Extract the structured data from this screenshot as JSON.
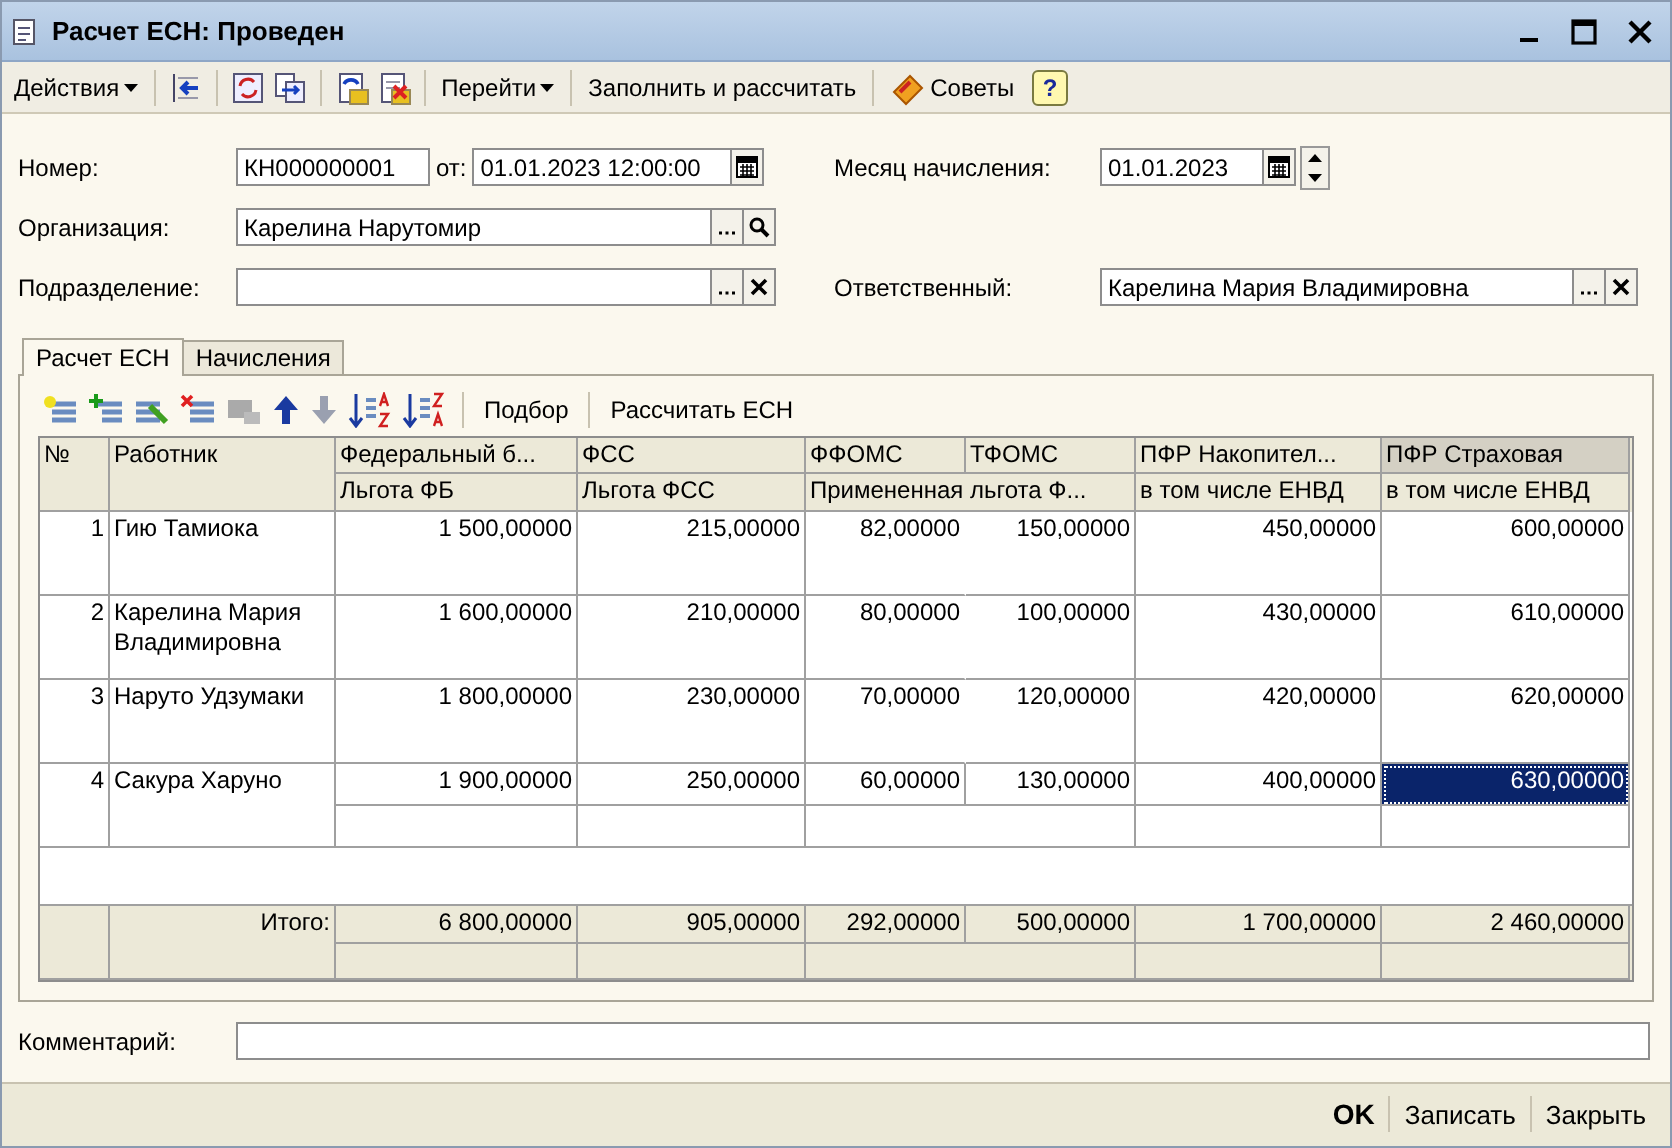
{
  "window": {
    "title": "Расчет ЕСН: Проведен"
  },
  "toolbar": {
    "actions_menu": "Действия",
    "goto_menu": "Перейти",
    "fill_button": "Заполнить и рассчитать",
    "tips_button": "Советы",
    "help_button": "?"
  },
  "form": {
    "number": {
      "label": "Номер:",
      "value": "КН000000001"
    },
    "date": {
      "label": "от:",
      "value": "01.01.2023 12:00:00"
    },
    "month": {
      "label": "Месяц начисления:",
      "value": "01.01.2023"
    },
    "organization": {
      "label": "Организация:",
      "value": "Карелина Нарутомир"
    },
    "subdivision": {
      "label": "Подразделение:"
    },
    "responsible": {
      "label": "Ответственный:",
      "value": "Карелина Мария Владимировна"
    }
  },
  "tabs": [
    {
      "label": "Расчет ЕСН",
      "selected": true
    },
    {
      "label": "Начисления",
      "selected": false
    }
  ],
  "table_toolbar": {
    "buttons": [
      "Подбор",
      "Рассчитать ЕСН"
    ]
  },
  "table": {
    "columns": [
      {
        "text": "№",
        "selected": false
      },
      {
        "text": "Работник",
        "selected": false
      },
      {
        "text": "Федеральный б...",
        "selected": false
      },
      {
        "text": "ФСС",
        "selected": false
      },
      {
        "text": "ФФОМС",
        "selected": false
      },
      {
        "text": "ТФОМС",
        "selected": false
      },
      {
        "text": "ПФР Накопител...",
        "selected": false
      },
      {
        "text": "ПФР Страховая",
        "selected": true
      }
    ],
    "subheaders": [
      "Льгота ФБ",
      "Льгота ФСС",
      "Примененная льгота Ф...",
      "в том числе ЕНВД",
      "в том числе ЕНВД"
    ],
    "rows": [
      {
        "num": "1",
        "name": "Гию Тамиока",
        "selected": false,
        "values": [
          {
            "text": "1 500,00000",
            "selected": false
          },
          {
            "text": "215,00000",
            "selected": false
          },
          {
            "text": "82,00000",
            "selected": false
          },
          {
            "text": "150,00000",
            "selected": false
          },
          {
            "text": "450,00000",
            "selected": false
          },
          {
            "text": "600,00000",
            "selected": false
          }
        ]
      },
      {
        "num": "2",
        "name": "Карелина Мария Владимировна",
        "selected": false,
        "values": [
          {
            "text": "1 600,00000",
            "selected": false
          },
          {
            "text": "210,00000",
            "selected": false
          },
          {
            "text": "80,00000",
            "selected": false
          },
          {
            "text": "100,00000",
            "selected": false
          },
          {
            "text": "430,00000",
            "selected": false
          },
          {
            "text": "610,00000",
            "selected": false
          }
        ]
      },
      {
        "num": "3",
        "name": "Наруто Удзумаки",
        "selected": false,
        "values": [
          {
            "text": "1 800,00000",
            "selected": false
          },
          {
            "text": "230,00000",
            "selected": false
          },
          {
            "text": "70,00000",
            "selected": false
          },
          {
            "text": "120,00000",
            "selected": false
          },
          {
            "text": "420,00000",
            "selected": false
          },
          {
            "text": "620,00000",
            "selected": false
          }
        ]
      },
      {
        "num": "4",
        "name": "Сакура Харуно",
        "selected": true,
        "values": [
          {
            "text": "1 900,00000",
            "selected": false
          },
          {
            "text": "250,00000",
            "selected": false
          },
          {
            "text": "60,00000",
            "selected": false
          },
          {
            "text": "130,00000",
            "selected": false
          },
          {
            "text": "400,00000",
            "selected": false
          },
          {
            "text": "630,00000",
            "selected": true
          }
        ]
      }
    ],
    "totals": {
      "label": "Итого:",
      "values": [
        "6 800,00000",
        "905,00000",
        "292,00000",
        "500,00000",
        "1 700,00000",
        "2 460,00000"
      ]
    }
  },
  "comment": {
    "label": "Комментарий:"
  },
  "buttons": [
    {
      "label": "OK",
      "default": true
    },
    {
      "label": "Записать",
      "default": false
    },
    {
      "label": "Закрыть",
      "default": false
    }
  ]
}
